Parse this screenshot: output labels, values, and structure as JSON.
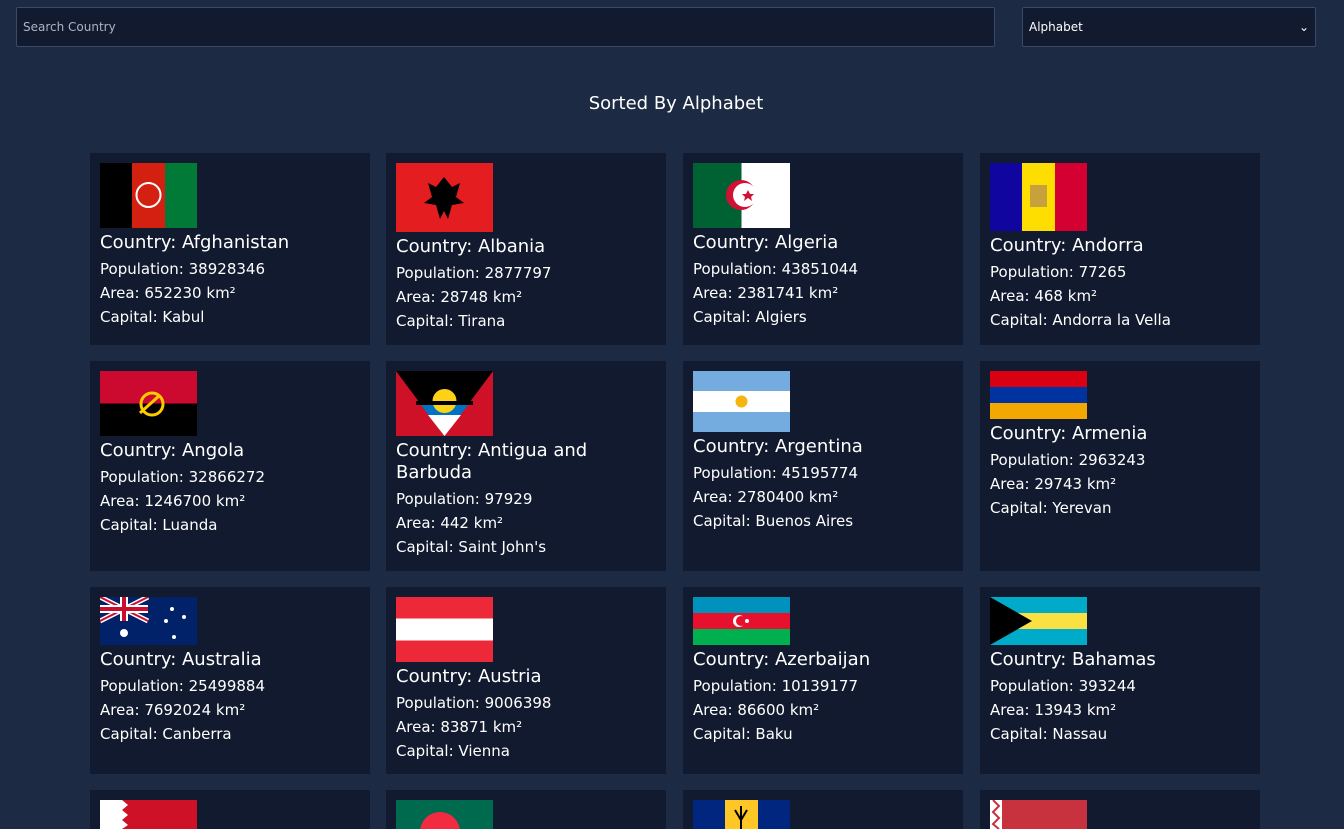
{
  "search": {
    "placeholder": "Search Country"
  },
  "sort": {
    "selected": "Alphabet"
  },
  "heading": "Sorted By Alphabet",
  "labels": {
    "country": "Country: ",
    "population": "Population: ",
    "area": "Area: ",
    "capital": "Capital: ",
    "unit": " km²"
  },
  "countries": [
    {
      "name": "Afghanistan",
      "population": "38928346",
      "area": "652230",
      "capital": "Kabul",
      "flag": "afghanistan-flag"
    },
    {
      "name": "Albania",
      "population": "2877797",
      "area": "28748",
      "capital": "Tirana",
      "flag": "albania-flag"
    },
    {
      "name": "Algeria",
      "population": "43851044",
      "area": "2381741",
      "capital": "Algiers",
      "flag": "algeria-flag"
    },
    {
      "name": "Andorra",
      "population": "77265",
      "area": "468",
      "capital": "Andorra la Vella",
      "flag": "andorra-flag"
    },
    {
      "name": "Angola",
      "population": "32866272",
      "area": "1246700",
      "capital": "Luanda",
      "flag": "angola-flag"
    },
    {
      "name": "Antigua and Barbuda",
      "population": "97929",
      "area": "442",
      "capital": "Saint John's",
      "flag": "antigua-flag"
    },
    {
      "name": "Argentina",
      "population": "45195774",
      "area": "2780400",
      "capital": "Buenos Aires",
      "flag": "argentina-flag"
    },
    {
      "name": "Armenia",
      "population": "2963243",
      "area": "29743",
      "capital": "Yerevan",
      "flag": "armenia-flag"
    },
    {
      "name": "Australia",
      "population": "25499884",
      "area": "7692024",
      "capital": "Canberra",
      "flag": "australia-flag"
    },
    {
      "name": "Austria",
      "population": "9006398",
      "area": "83871",
      "capital": "Vienna",
      "flag": "austria-flag"
    },
    {
      "name": "Azerbaijan",
      "population": "10139177",
      "area": "86600",
      "capital": "Baku",
      "flag": "azerbaijan-flag"
    },
    {
      "name": "Bahamas",
      "population": "393244",
      "area": "13943",
      "capital": "Nassau",
      "flag": "bahamas-flag"
    }
  ],
  "partial_flags": [
    "bahrain-flag",
    "bangladesh-flag",
    "barbados-flag",
    "belarus-flag"
  ]
}
